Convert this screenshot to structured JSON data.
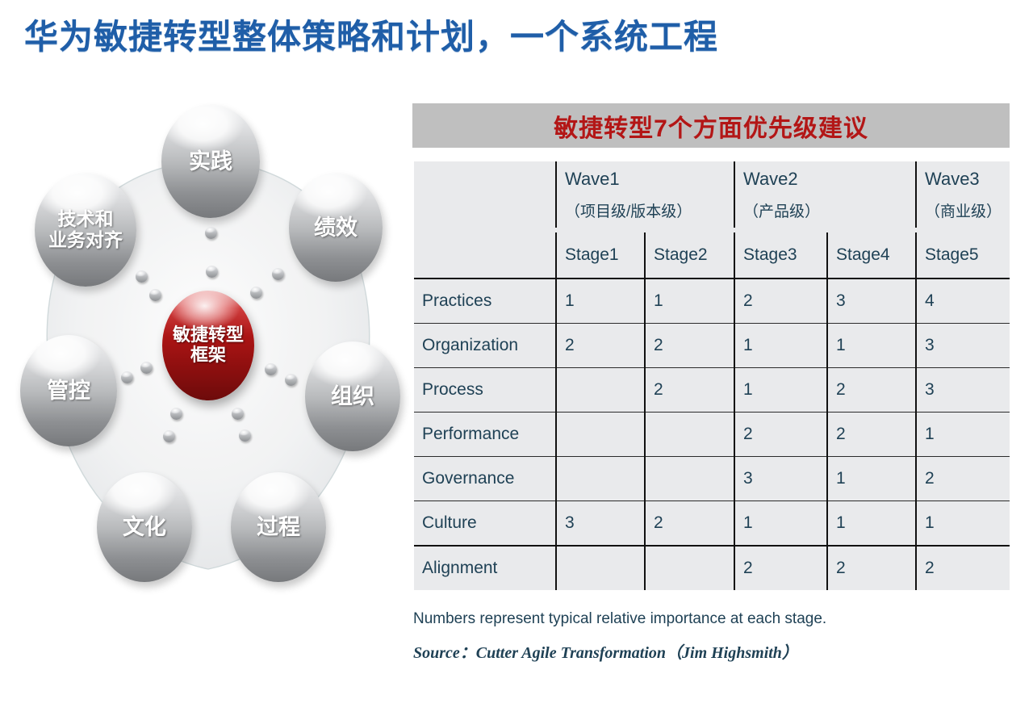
{
  "slide": {
    "title": "华为敏捷转型整体策略和计划，一个系统工程",
    "title_color": "#1f5ea8"
  },
  "diagram": {
    "name": "agile-transformation-framework",
    "center": {
      "label_line1": "敏捷转型",
      "label_line2": "框架",
      "color": "#a81414"
    },
    "nodes": [
      {
        "id": "practice",
        "label": "实践"
      },
      {
        "id": "performance",
        "label": "绩效"
      },
      {
        "id": "organization",
        "label": "组织"
      },
      {
        "id": "process",
        "label": "过程"
      },
      {
        "id": "culture",
        "label": "文化"
      },
      {
        "id": "governance",
        "label": "管控"
      },
      {
        "id": "alignment",
        "label_line1": "技术和",
        "label_line2": "业务对齐"
      }
    ]
  },
  "panel": {
    "banner": {
      "text": "敏捷转型7个方面优先级建议",
      "text_color": "#b31616",
      "bg_color": "#bfbfbf"
    },
    "footnote1": "Numbers represent typical relative importance at each stage.",
    "footnote2": "Source：Cutter Agile Transformation（Jim Highsmith）"
  },
  "chart_data": {
    "type": "table",
    "title": "敏捷转型7个方面优先级建议",
    "wave_headers": [
      {
        "name": "Wave1",
        "sub": "（项目级/版本级）",
        "colspan": 2
      },
      {
        "name": "Wave2",
        "sub": "（产品级）",
        "colspan": 2
      },
      {
        "name": "Wave3",
        "sub": "（商业级）",
        "colspan": 1
      }
    ],
    "corner_label": "",
    "stage_headers": [
      "Stage1",
      "Stage2",
      "Stage3",
      "Stage4",
      "Stage5"
    ],
    "categories": [
      "Practices",
      "Organization",
      "Process",
      "Performance",
      "Governance",
      "Culture",
      "Alignment"
    ],
    "rows": [
      {
        "label": "Practices",
        "values": [
          "1",
          "1",
          "2",
          "3",
          "4"
        ]
      },
      {
        "label": "Organization",
        "values": [
          "2",
          "2",
          "1",
          "1",
          "3"
        ]
      },
      {
        "label": "Process",
        "values": [
          "",
          "2",
          "1",
          "2",
          "3"
        ]
      },
      {
        "label": "Performance",
        "values": [
          "",
          "",
          "2",
          "2",
          "1"
        ]
      },
      {
        "label": "Governance",
        "values": [
          "",
          "",
          "3",
          "1",
          "2"
        ]
      },
      {
        "label": "Culture",
        "values": [
          "3",
          "2",
          "1",
          "1",
          "1"
        ]
      },
      {
        "label": "Alignment",
        "values": [
          "",
          "",
          "2",
          "2",
          "2"
        ]
      }
    ],
    "note": "Numbers represent typical relative importance at each stage.",
    "source": "Source：Cutter Agile Transformation（Jim Highsmith）"
  }
}
